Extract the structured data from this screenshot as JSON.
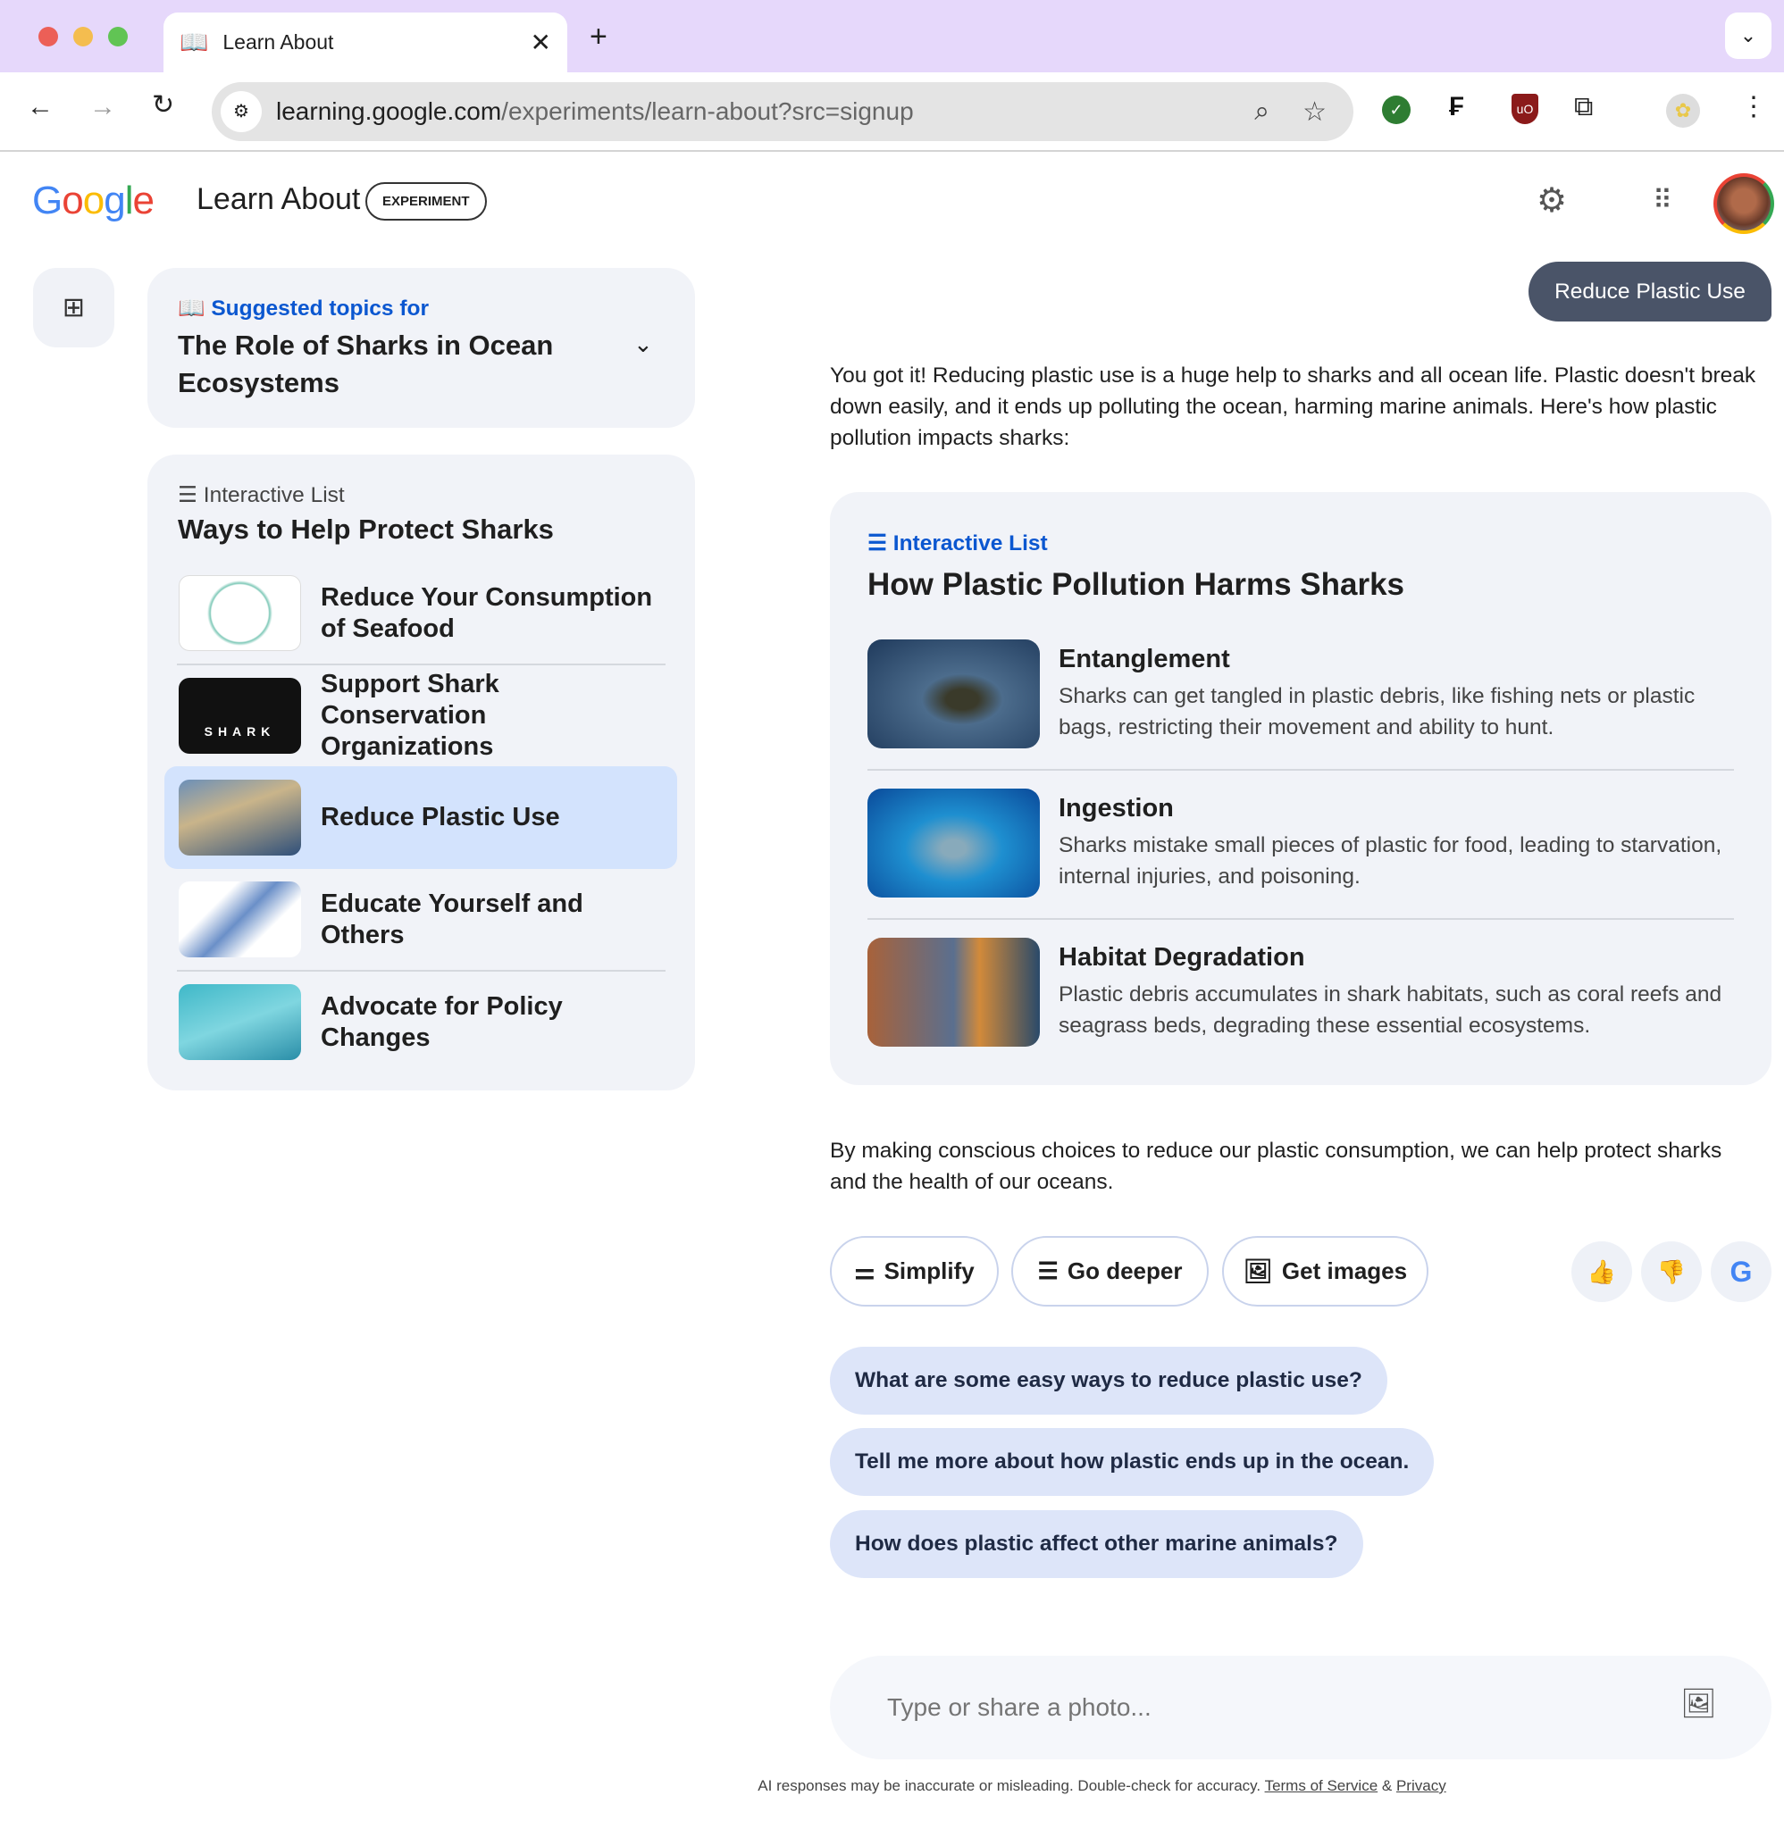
{
  "browser": {
    "tab_title": "Learn About",
    "url_host": "learning.google.com",
    "url_path": "/experiments/learn-about?src=signup"
  },
  "header": {
    "logo": "Google",
    "app_name": "Learn About",
    "badge": "EXPERIMENT"
  },
  "suggested": {
    "label": "Suggested topics for",
    "title": "The Role of Sharks in Ocean Ecosystems"
  },
  "left_list": {
    "label": "Interactive List",
    "title": "Ways to Help Protect Sharks",
    "items": [
      {
        "label": "Reduce Your Consumption of Seafood"
      },
      {
        "label": "Support Shark Conservation Organizations",
        "thumb_text": "SHARK"
      },
      {
        "label": "Reduce Plastic Use",
        "selected": true
      },
      {
        "label": "Educate Yourself and Others"
      },
      {
        "label": "Advocate for Policy Changes"
      }
    ]
  },
  "chat": {
    "user_message": "Reduce Plastic Use",
    "intro": "You got it! Reducing plastic use is a huge help to sharks and all ocean life. Plastic doesn't break down easily, and it ends up polluting the ocean, harming marine animals. Here's how plastic pollution impacts sharks:",
    "list": {
      "label": "Interactive List",
      "title": "How Plastic Pollution Harms Sharks",
      "items": [
        {
          "title": "Entanglement",
          "desc": "Sharks can get tangled in plastic debris, like fishing nets or plastic bags, restricting their movement and ability to hunt."
        },
        {
          "title": "Ingestion",
          "desc": "Sharks mistake small pieces of plastic for food, leading to starvation, internal injuries, and poisoning."
        },
        {
          "title": "Habitat Degradation",
          "desc": "Plastic debris accumulates in shark habitats, such as coral reefs and seagrass beds, degrading these essential ecosystems."
        }
      ]
    },
    "outro": "By making conscious choices to reduce our plastic consumption, we can help protect sharks and the health of our oceans.",
    "actions": {
      "simplify": "Simplify",
      "deeper": "Go deeper",
      "images": "Get images"
    },
    "followups": [
      "What are some easy ways to reduce plastic use?",
      "Tell me more about how plastic ends up in the ocean.",
      "How does plastic affect other marine animals?"
    ]
  },
  "input": {
    "placeholder": "Type or share a photo..."
  },
  "footer": {
    "disclaimer": "AI responses may be inaccurate or misleading. Double-check for accuracy.",
    "terms": "Terms of Service",
    "amp": "&",
    "privacy": "Privacy"
  },
  "colors": {
    "accent": "#0b57d0",
    "tab_bar": "#e6d8fb",
    "user_bubble": "#4a5468",
    "selected": "#d3e3fd"
  }
}
